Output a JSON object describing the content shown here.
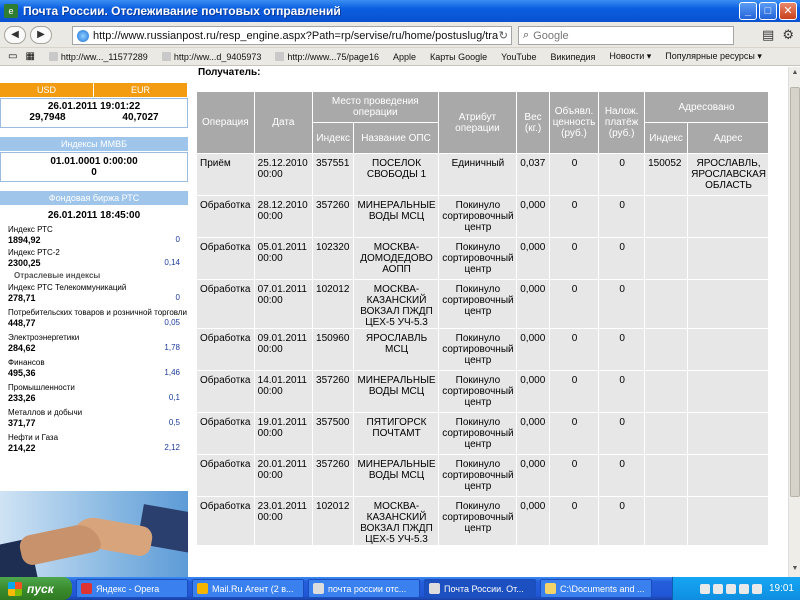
{
  "window": {
    "title": "Почта России. Отслеживание почтовых отправлений",
    "min": "_",
    "max": "□",
    "close": "✕"
  },
  "nav": {
    "back": "◀",
    "forward": "▶",
    "url": "http://www.russianpost.ru/resp_engine.aspx?Path=rp/servise/ru/home/postuslug/trackingpo",
    "search_placeholder": "Google"
  },
  "bookmarks": [
    "http://ww..._11577289",
    "http://ww...d_9405973",
    "http://www...75/page16",
    "Apple",
    "Карты Google",
    "YouTube",
    "Википедия",
    "Новости ▾",
    "Популярные ресурсы ▾"
  ],
  "sidebar": {
    "currency": {
      "usd": "USD",
      "eur": "EUR",
      "date": "26.01.2011 19:01:22",
      "usd_val": "29,7948",
      "eur_val": "40,7027"
    },
    "mmvb": {
      "title": "Индексы ММВБ",
      "date": "01.01.0001 0:00:00",
      "value": "0"
    },
    "rts": {
      "title": "Фондовая биржа РТС",
      "date": "26.01.2011 18:45:00",
      "main": [
        {
          "name": "Индекс РТС",
          "value": "1894,92",
          "change": "0"
        },
        {
          "name": "Индекс РТС-2",
          "value": "2300,25",
          "change": "0,14"
        }
      ],
      "section": "Отраслевые индексы",
      "sector": [
        {
          "name": "Индекс РТС Телекоммуникаций",
          "value": "278,71",
          "change": "0"
        },
        {
          "name": "Потребительских товаров и розничной торговли",
          "value": "448,77",
          "change": "0,05"
        },
        {
          "name": "Электроэнергетики",
          "value": "284,62",
          "change": "1,78"
        },
        {
          "name": "Финансов",
          "value": "495,36",
          "change": "1,46"
        },
        {
          "name": "Промышленности",
          "value": "233,26",
          "change": "0,1"
        },
        {
          "name": "Металлов и добычи",
          "value": "371,77",
          "change": "0,5"
        },
        {
          "name": "Нефти и Газа",
          "value": "214,22",
          "change": "2,12"
        }
      ]
    }
  },
  "main": {
    "recipient_label": "Получатель:",
    "headers": {
      "operation": "Операция",
      "date": "Дата",
      "place": "Место проведения операции",
      "index": "Индекс",
      "ops_name": "Название ОПС",
      "attribute": "Атрибут операции",
      "weight": "Вес (кг.)",
      "declared": "Объявл. ценность (руб.)",
      "cod": "Налож. платёж (руб.)",
      "addressed": "Адресовано",
      "addr_index": "Индекс",
      "address": "Адрес"
    },
    "rows": [
      {
        "op": "Приём",
        "date": "25.12.2010 00:00",
        "idx": "357551",
        "name": "ПОСЕЛОК СВОБОДЫ 1",
        "attr": "Единичный",
        "weight": "0,037",
        "declared": "0",
        "cod": "0",
        "to_idx": "150052",
        "to_addr": "ЯРОСЛАВЛЬ, ЯРОСЛАВСКАЯ ОБЛАСТЬ"
      },
      {
        "op": "Обработка",
        "date": "28.12.2010 00:00",
        "idx": "357260",
        "name": "МИНЕРАЛЬНЫЕ ВОДЫ МСЦ",
        "attr": "Покинуло сортировочный центр",
        "weight": "0,000",
        "declared": "0",
        "cod": "0",
        "to_idx": "",
        "to_addr": ""
      },
      {
        "op": "Обработка",
        "date": "05.01.2011 00:00",
        "idx": "102320",
        "name": "МОСКВА-ДОМОДЕДОВО АОПП",
        "attr": "Покинуло сортировочный центр",
        "weight": "0,000",
        "declared": "0",
        "cod": "0",
        "to_idx": "",
        "to_addr": ""
      },
      {
        "op": "Обработка",
        "date": "07.01.2011 00:00",
        "idx": "102012",
        "name": "МОСКВА-КАЗАНСКИЙ ВОКЗАЛ ПЖДП ЦЕХ-5 УЧ-5.3",
        "attr": "Покинуло сортировочный центр",
        "weight": "0,000",
        "declared": "0",
        "cod": "0",
        "to_idx": "",
        "to_addr": ""
      },
      {
        "op": "Обработка",
        "date": "09.01.2011 00:00",
        "idx": "150960",
        "name": "ЯРОСЛАВЛЬ МСЦ",
        "attr": "Покинуло сортировочный центр",
        "weight": "0,000",
        "declared": "0",
        "cod": "0",
        "to_idx": "",
        "to_addr": ""
      },
      {
        "op": "Обработка",
        "date": "14.01.2011 00:00",
        "idx": "357260",
        "name": "МИНЕРАЛЬНЫЕ ВОДЫ МСЦ",
        "attr": "Покинуло сортировочный центр",
        "weight": "0,000",
        "declared": "0",
        "cod": "0",
        "to_idx": "",
        "to_addr": ""
      },
      {
        "op": "Обработка",
        "date": "19.01.2011 00:00",
        "idx": "357500",
        "name": "ПЯТИГОРСК ПОЧТАМТ",
        "attr": "Покинуло сортировочный центр",
        "weight": "0,000",
        "declared": "0",
        "cod": "0",
        "to_idx": "",
        "to_addr": ""
      },
      {
        "op": "Обработка",
        "date": "20.01.2011 00:00",
        "idx": "357260",
        "name": "МИНЕРАЛЬНЫЕ ВОДЫ МСЦ",
        "attr": "Покинуло сортировочный центр",
        "weight": "0,000",
        "declared": "0",
        "cod": "0",
        "to_idx": "",
        "to_addr": ""
      },
      {
        "op": "Обработка",
        "date": "23.01.2011 00:00",
        "idx": "102012",
        "name": "МОСКВА-КАЗАНСКИЙ ВОКЗАЛ ПЖДП ЦЕХ-5 УЧ-5.3",
        "attr": "Покинуло сортировочный центр",
        "weight": "0,000",
        "declared": "0",
        "cod": "0",
        "to_idx": "",
        "to_addr": ""
      }
    ]
  },
  "taskbar": {
    "start": "пуск",
    "tasks": [
      "Яндекс - Opera",
      "Mail.Ru Агент (2 в...",
      "почта россии отс...",
      "Почта России. От...",
      "C:\\Documents and ..."
    ],
    "clock": "19:01"
  }
}
